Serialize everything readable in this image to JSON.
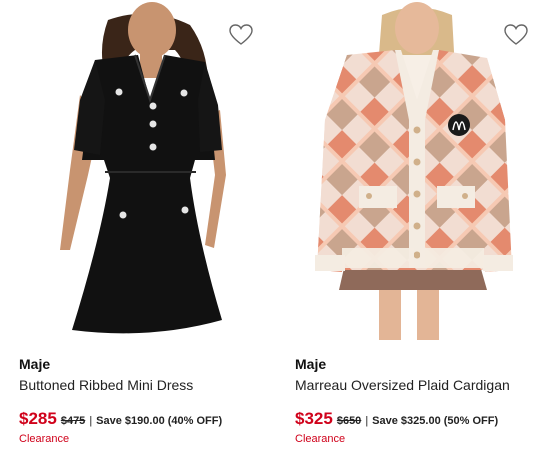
{
  "products": [
    {
      "brand": "Maje",
      "name": "Buttoned Ribbed Mini Dress",
      "sale_price": "$285",
      "original_price": "$475",
      "separator": "|",
      "savings": "Save $190.00 (40% OFF)",
      "badge": "Clearance",
      "image_icon": "black-knit-dress-photo",
      "favorite_icon": "heart-outline-icon"
    },
    {
      "brand": "Maje",
      "name": "Marreau Oversized Plaid Cardigan",
      "sale_price": "$325",
      "original_price": "$650",
      "separator": "|",
      "savings": "Save $325.00 (50% OFF)",
      "badge": "Clearance",
      "image_icon": "plaid-cardigan-photo",
      "favorite_icon": "heart-outline-icon"
    }
  ],
  "colors": {
    "sale": "#d0021b",
    "text": "#222222"
  }
}
